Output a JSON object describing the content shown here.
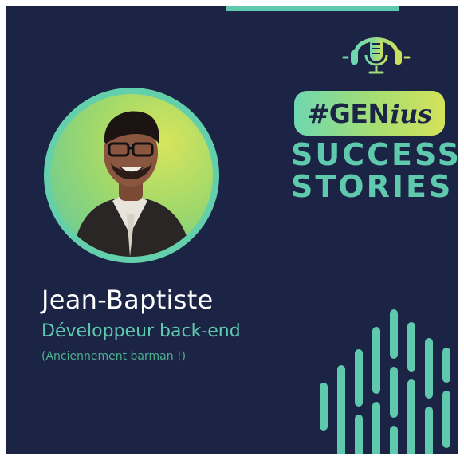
{
  "badge": {
    "prefix": "#GEN",
    "suffix": "ius"
  },
  "title": {
    "line1": "SUCCESS",
    "line2": "STORIES"
  },
  "person": {
    "name": "Jean-Baptiste",
    "role": "Développeur back-end",
    "previous": "(Anciennement barman !)"
  },
  "icons": {
    "podcast": "headphones-microphone-icon",
    "decoration": "sound-wave-icon"
  },
  "colors": {
    "background": "#1c2446",
    "accent": "#5fc9ad",
    "accent_yellow": "#d4e25a",
    "text": "#ffffff"
  }
}
